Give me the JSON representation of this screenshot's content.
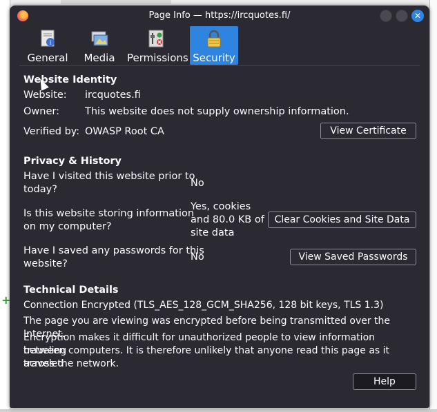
{
  "window": {
    "title": "Page Info — https://ircquotes.fi/"
  },
  "tabs": [
    {
      "label": "General",
      "icon": "info-document-icon"
    },
    {
      "label": "Media",
      "icon": "media-icon"
    },
    {
      "label": "Permissions",
      "icon": "permissions-icon"
    },
    {
      "label": "Security",
      "icon": "lock-icon",
      "active": true
    }
  ],
  "identity": {
    "heading": "Website Identity",
    "website_label": "Website:",
    "website_value": "ircquotes.fi",
    "owner_label": "Owner:",
    "owner_value": "This website does not supply ownership information.",
    "verified_label": "Verified by:",
    "verified_value": "OWASP Root CA",
    "view_certificate": "View Certificate"
  },
  "privacy": {
    "heading": "Privacy & History",
    "q1_line1": "Have I visited this website prior to",
    "q1_line2": "today?",
    "a1": "No",
    "q2_line1": "Is this website storing information",
    "q2_line2": "on my computer?",
    "a2_line1": "Yes, cookies",
    "a2_line2": "and 80.0 KB of",
    "a2_line3": "site data",
    "clear_button": "Clear Cookies and Site Data",
    "q3_line1": "Have I saved any passwords for this",
    "q3_line2": "website?",
    "a3": "No",
    "view_passwords": "View Saved Passwords"
  },
  "technical": {
    "heading": "Technical Details",
    "connection": "Connection Encrypted (TLS_AES_128_GCM_SHA256, 128 bit keys, TLS 1.3)",
    "para1": "The page you are viewing was encrypted before being transmitted over the Internet.",
    "para2_line1": "Encryption makes it difficult for unauthorized people to view information traveling",
    "para2_line2": "between computers. It is therefore unlikely that anyone read this page as it traveled",
    "para2_line3": "across the network."
  },
  "help_button": "Help",
  "colors": {
    "dialog_bg": "#2b2a33",
    "accent": "#2f84e0",
    "text": "#fbfbfe"
  }
}
